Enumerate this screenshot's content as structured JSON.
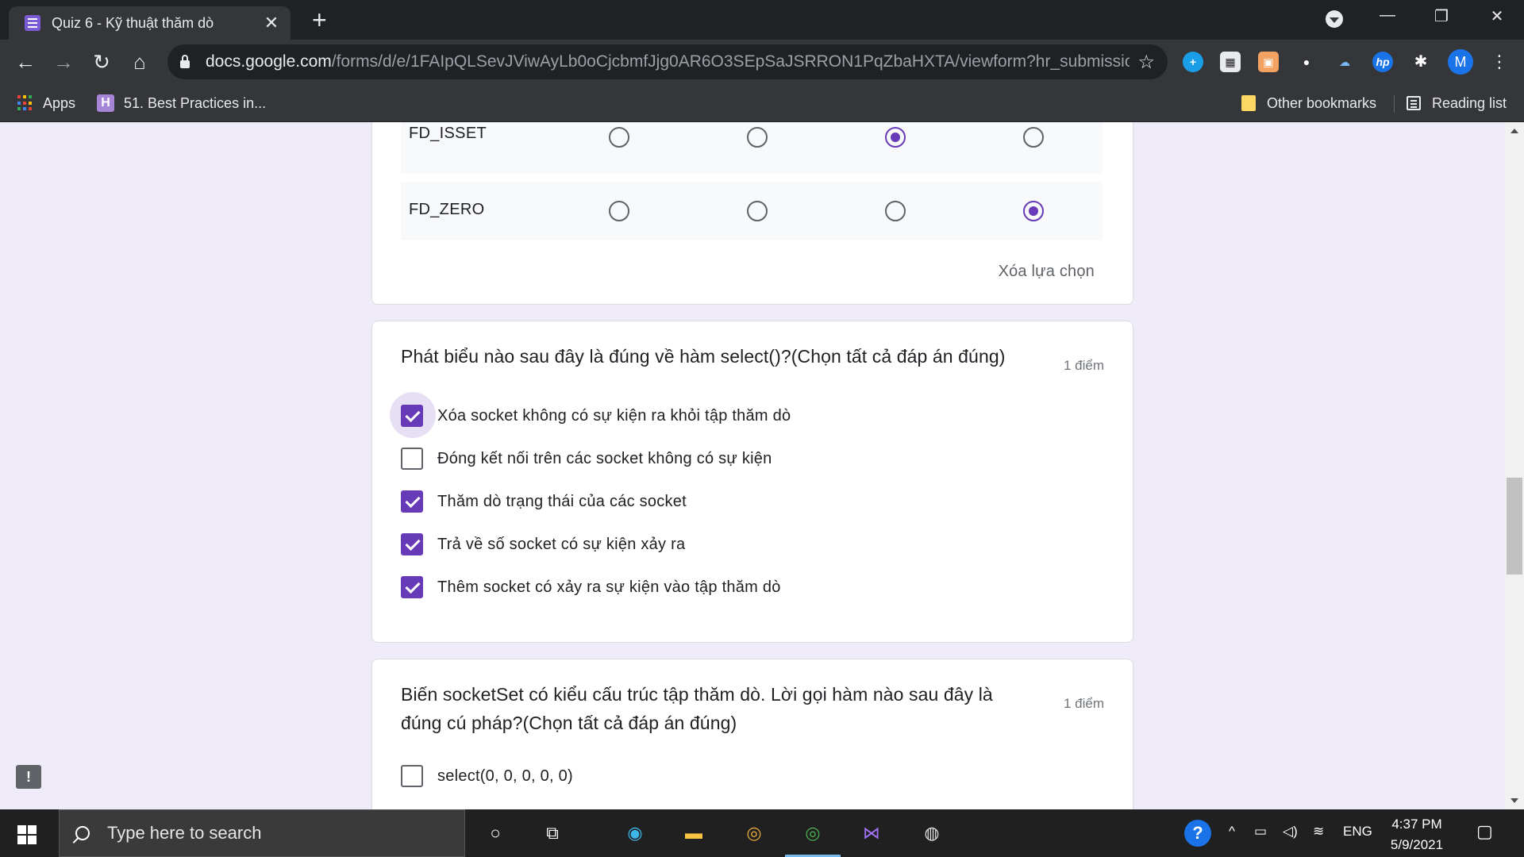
{
  "browser": {
    "tab_title": "Quiz 6 - Kỹ thuật thăm dò",
    "url_host": "docs.google.com",
    "url_path": "/forms/d/e/1FAIpQLSevJViwAyLb0oCjcbmfJjg0AR6O3SEpSaJSRRON1PqZbaHXTA/viewform?hr_submissio...",
    "profile_initial": "M",
    "bookmarks": {
      "apps": "Apps",
      "item1": "51. Best Practices in...",
      "item1_icon_letter": "H",
      "other": "Other bookmarks",
      "reading": "Reading list"
    }
  },
  "form": {
    "grid_rows": [
      {
        "label": "FD_ISSET",
        "selected_column": 3
      },
      {
        "label": "FD_ZERO",
        "selected_column": 4
      }
    ],
    "clear_selection": "Xóa lựa chọn",
    "question1": {
      "title": "Phát biểu nào sau đây là đúng về hàm select()?(Chọn tất cả đáp án đúng)",
      "points": "1 điểm",
      "options": [
        {
          "label": "Xóa socket không có sự kiện ra khỏi tập thăm dò",
          "checked": true
        },
        {
          "label": "Đóng kết nối trên các socket không có sự kiện",
          "checked": false
        },
        {
          "label": "Thăm dò trạng thái của các socket",
          "checked": true
        },
        {
          "label": "Trả về số socket có sự kiện xảy ra",
          "checked": true
        },
        {
          "label": "Thêm socket có xảy ra sự kiện vào tập thăm dò",
          "checked": true
        }
      ]
    },
    "question2": {
      "title_line1": "Biến socketSet có kiểu cấu trúc tập thăm dò. Lời gọi hàm nào sau đây là",
      "title_line2": "đúng cú pháp?(Chọn tất cả đáp án đúng)",
      "points": "1 điểm",
      "options": [
        {
          "label": "select(0, 0, 0, 0, 0)",
          "checked": false
        }
      ]
    },
    "report_icon": "!"
  },
  "taskbar": {
    "search_placeholder": "Type here to search",
    "language": "ENG",
    "time": "4:37 PM",
    "date": "5/9/2021"
  },
  "colors": {
    "accent": "#673ab7",
    "page_bg": "#efebf8"
  }
}
